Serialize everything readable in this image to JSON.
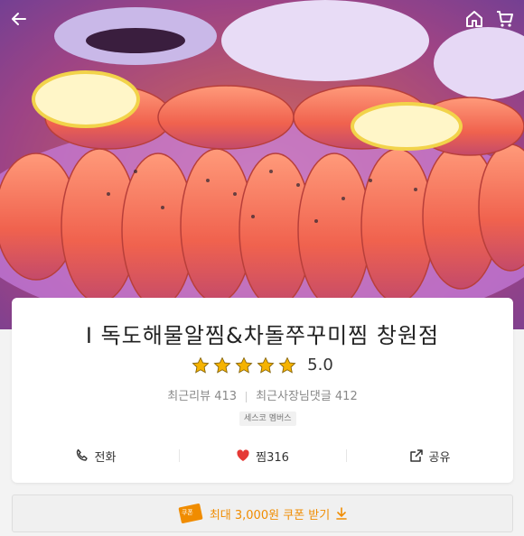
{
  "header": {
    "back_icon": "arrow-left-icon",
    "home_icon": "home-icon",
    "cart_icon": "cart-icon"
  },
  "store": {
    "name": "I 독도해물알찜&차돌쭈꾸미찜 창원점",
    "rating": 5.0,
    "rating_text": "5.0",
    "stars": 5,
    "recent_reviews": "최근리뷰 413",
    "owner_replies": "최근사장님댓글 412",
    "tag": "세스코 멤버스"
  },
  "actions": {
    "call_label": "전화",
    "like_label": "찜316",
    "share_label": "공유"
  },
  "coupon": {
    "badge": "쿠폰",
    "label": "최대 3,000원 쿠폰 받기"
  },
  "colors": {
    "star": "#f5b301",
    "heart": "#e53935",
    "coupon": "#f08c00"
  }
}
